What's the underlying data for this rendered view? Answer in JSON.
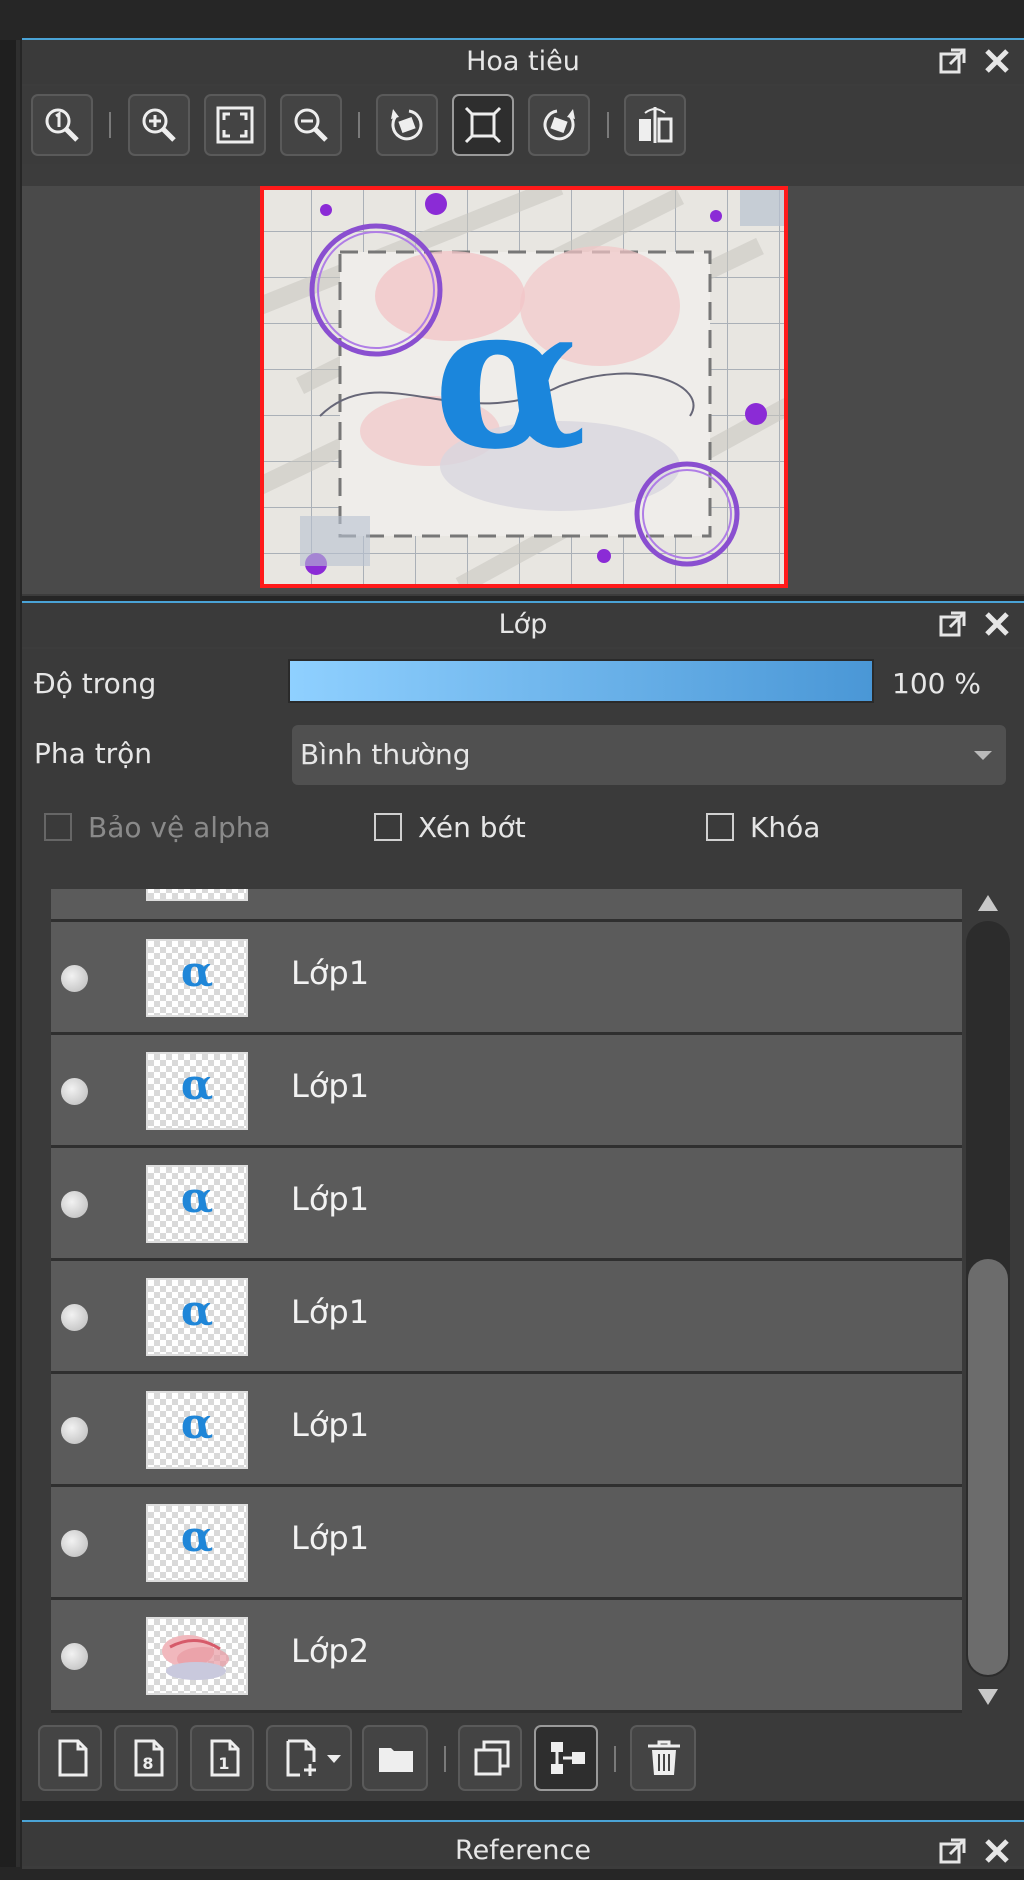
{
  "navigator": {
    "title": "Hoa tiêu",
    "toolbar_icons": [
      "zoom-actual-icon",
      "zoom-in-icon",
      "fit-screen-icon",
      "zoom-out-icon",
      "rotate-left-icon",
      "fit-window-icon",
      "rotate-right-icon",
      "flip-horizontal-icon"
    ]
  },
  "layers": {
    "title": "Lớp",
    "opacity_label": "Độ trong",
    "opacity_value": 100,
    "opacity_text": "100 %",
    "blend_label": "Pha trộn",
    "blend_value": "Bình thường",
    "protect_alpha_label": "Bảo vệ alpha",
    "clip_label": "Xén bớt",
    "lock_label": "Khóa",
    "items": [
      {
        "name": "Lớp1",
        "thumb": "alpha"
      },
      {
        "name": "Lớp1",
        "thumb": "alpha"
      },
      {
        "name": "Lớp1",
        "thumb": "alpha"
      },
      {
        "name": "Lớp1",
        "thumb": "alpha"
      },
      {
        "name": "Lớp1",
        "thumb": "alpha"
      },
      {
        "name": "Lớp1",
        "thumb": "alpha"
      },
      {
        "name": "Lớp2",
        "thumb": "shapes"
      }
    ],
    "bottom_icons": [
      "new-layer-icon",
      "new-8bit-layer-icon",
      "new-1bit-layer-icon",
      "add-layer-dropdown-icon",
      "new-folder-icon",
      "duplicate-layer-icon",
      "merge-down-icon",
      "delete-layer-icon"
    ]
  },
  "reference": {
    "title": "Reference"
  },
  "colors": {
    "accent": "#4aa3d6",
    "selection_red": "#ff1a1a",
    "alpha_blue": "#1f86d8"
  }
}
